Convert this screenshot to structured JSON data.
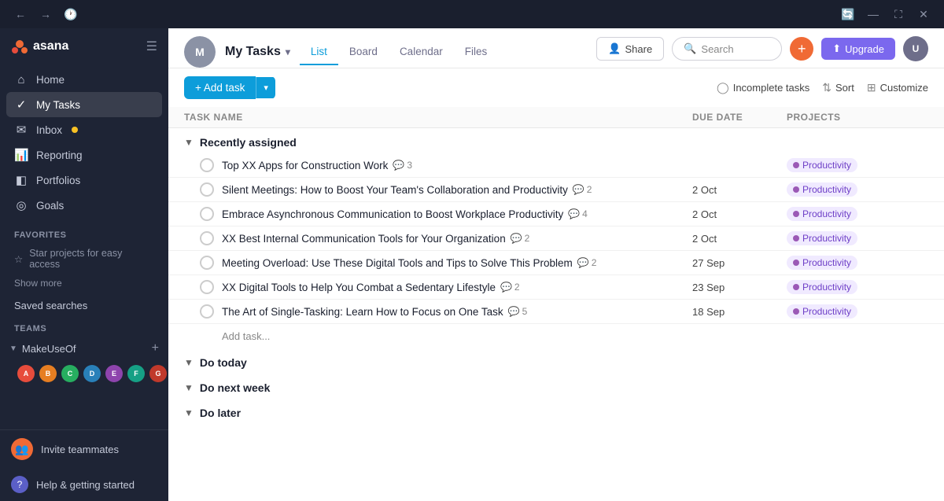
{
  "titlebar": {
    "back_label": "←",
    "forward_label": "→",
    "history_label": "🕐"
  },
  "sidebar": {
    "logo_text": "asana",
    "nav_items": [
      {
        "id": "home",
        "label": "Home",
        "icon": "⌂",
        "active": false
      },
      {
        "id": "my-tasks",
        "label": "My Tasks",
        "icon": "✓",
        "active": true
      },
      {
        "id": "inbox",
        "label": "Inbox",
        "icon": "✉",
        "active": false,
        "dot": true
      },
      {
        "id": "reporting",
        "label": "Reporting",
        "icon": "◫",
        "active": false
      },
      {
        "id": "portfolios",
        "label": "Portfolios",
        "icon": "◧",
        "active": false
      },
      {
        "id": "goals",
        "label": "Goals",
        "icon": "◎",
        "active": false
      }
    ],
    "favorites_label": "Favorites",
    "star_projects_label": "Star projects for easy access",
    "show_more_label": "Show more",
    "saved_searches_label": "Saved searches",
    "teams_label": "Teams",
    "team_name": "MakeUseOf",
    "avatars": [
      {
        "color": "#e74c3c",
        "initials": "A"
      },
      {
        "color": "#e67e22",
        "initials": "B"
      },
      {
        "color": "#27ae60",
        "initials": "C"
      },
      {
        "color": "#2980b9",
        "initials": "D"
      },
      {
        "color": "#8e44ad",
        "initials": "E"
      },
      {
        "color": "#16a085",
        "initials": "F"
      },
      {
        "color": "#c0392b",
        "initials": "G"
      }
    ],
    "invite_label": "Invite teammates",
    "help_label": "Help & getting started"
  },
  "topbar": {
    "page_title": "My Tasks",
    "tabs": [
      {
        "id": "list",
        "label": "List",
        "active": true
      },
      {
        "id": "board",
        "label": "Board",
        "active": false
      },
      {
        "id": "calendar",
        "label": "Calendar",
        "active": false
      },
      {
        "id": "files",
        "label": "Files",
        "active": false
      }
    ],
    "share_label": "Share",
    "search_placeholder": "Search",
    "upgrade_label": "Upgrade",
    "upgrade_icon": "⬆"
  },
  "toolbar": {
    "add_task_label": "+ Add task",
    "incomplete_tasks_label": "Incomplete tasks",
    "sort_label": "Sort",
    "customize_label": "Customize"
  },
  "table": {
    "col_task_name": "Task name",
    "col_due_date": "Due date",
    "col_projects": "Projects",
    "sections": [
      {
        "id": "recently-assigned",
        "title": "Recently assigned",
        "collapsed": false,
        "tasks": [
          {
            "id": 1,
            "name": "Top XX Apps for Construction Work",
            "comments": 3,
            "due_date": "",
            "project": "Productivity"
          },
          {
            "id": 2,
            "name": "Silent Meetings: How to Boost Your Team's Collaboration and Productivity",
            "comments": 2,
            "due_date": "2 Oct",
            "project": "Productivity"
          },
          {
            "id": 3,
            "name": "Embrace Asynchronous Communication to Boost Workplace Productivity",
            "comments": 4,
            "due_date": "2 Oct",
            "project": "Productivity"
          },
          {
            "id": 4,
            "name": "XX Best Internal Communication Tools for Your Organization",
            "comments": 2,
            "due_date": "2 Oct",
            "project": "Productivity"
          },
          {
            "id": 5,
            "name": "Meeting Overload: Use These Digital Tools and Tips to Solve This Problem",
            "comments": 2,
            "due_date": "27 Sep",
            "project": "Productivity"
          },
          {
            "id": 6,
            "name": "XX Digital Tools to Help You Combat a Sedentary Lifestyle",
            "comments": 2,
            "due_date": "23 Sep",
            "project": "Productivity"
          },
          {
            "id": 7,
            "name": "The Art of Single-Tasking: Learn How to Focus on One Task",
            "comments": 5,
            "due_date": "18 Sep",
            "project": "Productivity"
          }
        ],
        "add_task_label": "Add task..."
      },
      {
        "id": "do-today",
        "title": "Do today",
        "collapsed": true,
        "tasks": []
      },
      {
        "id": "do-next-week",
        "title": "Do next week",
        "collapsed": true,
        "tasks": []
      },
      {
        "id": "do-later",
        "title": "Do later",
        "collapsed": true,
        "tasks": []
      }
    ]
  }
}
